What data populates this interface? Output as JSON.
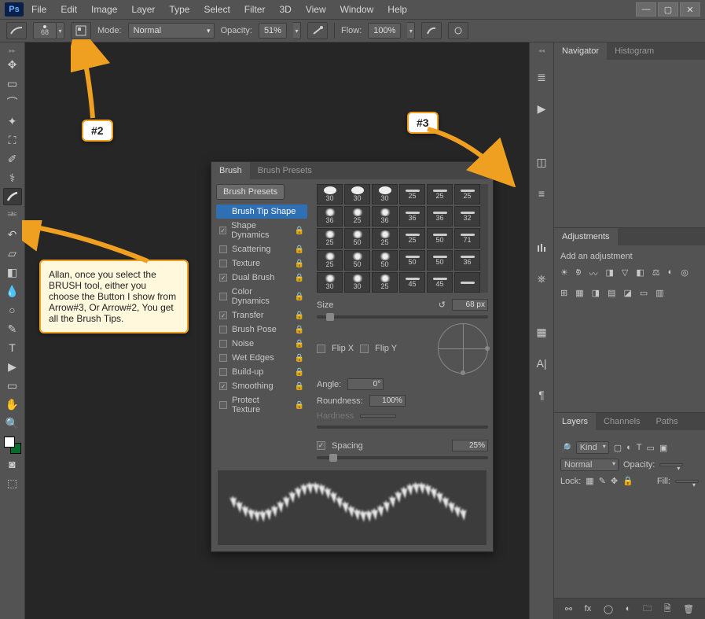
{
  "app": {
    "logo": "Ps"
  },
  "menu": [
    "File",
    "Edit",
    "Image",
    "Layer",
    "Type",
    "Select",
    "Filter",
    "3D",
    "View",
    "Window",
    "Help"
  ],
  "options": {
    "brush_size": "68",
    "mode_label": "Mode:",
    "mode_value": "Normal",
    "opacity_label": "Opacity:",
    "opacity_value": "51%",
    "flow_label": "Flow:",
    "flow_value": "100%"
  },
  "brush_panel": {
    "tabs": [
      "Brush",
      "Brush Presets"
    ],
    "presets_button": "Brush Presets",
    "sections": [
      {
        "label": "Brush Tip Shape",
        "checked": null,
        "locked": false,
        "highlight": true
      },
      {
        "label": "Shape Dynamics",
        "checked": true,
        "locked": true
      },
      {
        "label": "Scattering",
        "checked": false,
        "locked": true
      },
      {
        "label": "Texture",
        "checked": false,
        "locked": true
      },
      {
        "label": "Dual Brush",
        "checked": true,
        "locked": true
      },
      {
        "label": "Color Dynamics",
        "checked": false,
        "locked": true
      },
      {
        "label": "Transfer",
        "checked": true,
        "locked": true
      },
      {
        "label": "Brush Pose",
        "checked": false,
        "locked": true
      },
      {
        "label": "Noise",
        "checked": false,
        "locked": true
      },
      {
        "label": "Wet Edges",
        "checked": false,
        "locked": true
      },
      {
        "label": "Build-up",
        "checked": false,
        "locked": true
      },
      {
        "label": "Smoothing",
        "checked": true,
        "locked": true
      },
      {
        "label": "Protect Texture",
        "checked": false,
        "locked": true
      }
    ],
    "tips": [
      [
        "30",
        "30",
        "30",
        "25",
        "25",
        "25"
      ],
      [
        "36",
        "25",
        "36",
        "36",
        "36",
        "32"
      ],
      [
        "25",
        "50",
        "25",
        "25",
        "50",
        "71"
      ],
      [
        "25",
        "50",
        "50",
        "50",
        "50",
        "36"
      ],
      [
        "30",
        "30",
        "25",
        "45",
        "45",
        ""
      ]
    ],
    "size_label": "Size",
    "size_value": "68 px",
    "flipx_label": "Flip X",
    "flipy_label": "Flip Y",
    "angle_label": "Angle:",
    "angle_value": "0°",
    "roundness_label": "Roundness:",
    "roundness_value": "100%",
    "hardness_label": "Hardness",
    "spacing_label": "Spacing",
    "spacing_value": "25%"
  },
  "panels": {
    "nav_tabs": [
      "Navigator",
      "Histogram"
    ],
    "adj_title": "Adjustments",
    "adj_text": "Add an adjustment",
    "layers_tabs": [
      "Layers",
      "Channels",
      "Paths"
    ],
    "kind_label": "Kind",
    "blend_value": "Normal",
    "opacity_label": "Opacity:",
    "lock_label": "Lock:",
    "fill_label": "Fill:"
  },
  "callout": {
    "tag2": "#2",
    "tag3": "#3",
    "text": "Allan, once you select the BRUSH tool, either you choose the Button I show from Arrow#3, Or Arrow#2, You get all the Brush Tips."
  }
}
